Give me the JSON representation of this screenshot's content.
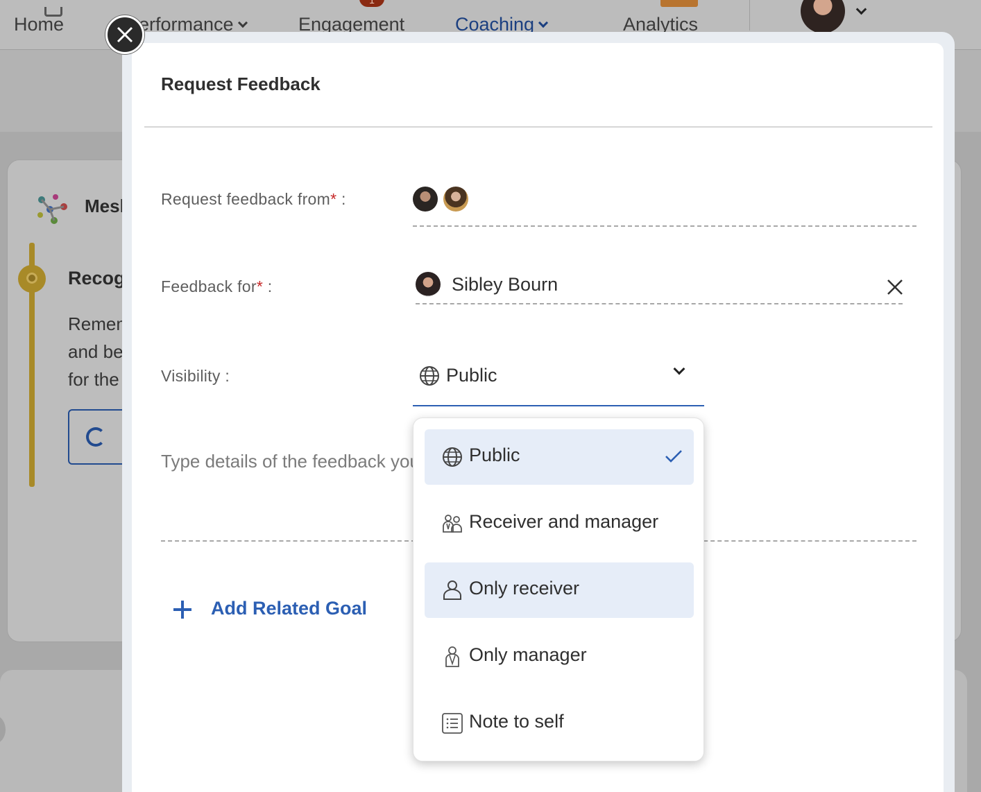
{
  "nav": {
    "items": [
      {
        "label": "Home"
      },
      {
        "label": "Performance"
      },
      {
        "label": "Engagement"
      },
      {
        "label": "Coaching"
      },
      {
        "label": "Analytics"
      }
    ],
    "engagement_badge": "1",
    "active_color": "#1b3f80"
  },
  "background": {
    "widget_title": "Mesh",
    "card_title": "Recognition",
    "card_lines": [
      "Remember",
      "and be",
      "for the"
    ]
  },
  "modal": {
    "title": "Request Feedback",
    "close_icon": "close-icon",
    "request_from": {
      "label": "Request feedback from",
      "required": "*",
      "suffix": " :"
    },
    "feedback_for": {
      "label": "Feedback for",
      "required": "*",
      "suffix": " :",
      "value": "Sibley Bourn"
    },
    "visibility": {
      "label": "Visibility :",
      "value": "Public",
      "icon": "globe-icon"
    },
    "details_placeholder": "Type details of the feedback you",
    "add_goal_label": "Add Related Goal",
    "accent": "#2c5fb3",
    "required_color": "#c62828"
  },
  "dropdown": {
    "options": [
      {
        "label": "Public",
        "icon": "globe-icon",
        "selected": true
      },
      {
        "label": "Receiver and manager",
        "icon": "receiver-and-manager-icon",
        "selected": false
      },
      {
        "label": "Only receiver",
        "icon": "person-icon",
        "selected": false
      },
      {
        "label": "Only manager",
        "icon": "manager-icon",
        "selected": false
      },
      {
        "label": "Note to self",
        "icon": "note-icon",
        "selected": false
      }
    ],
    "highlight_color": "#e6edf8"
  }
}
